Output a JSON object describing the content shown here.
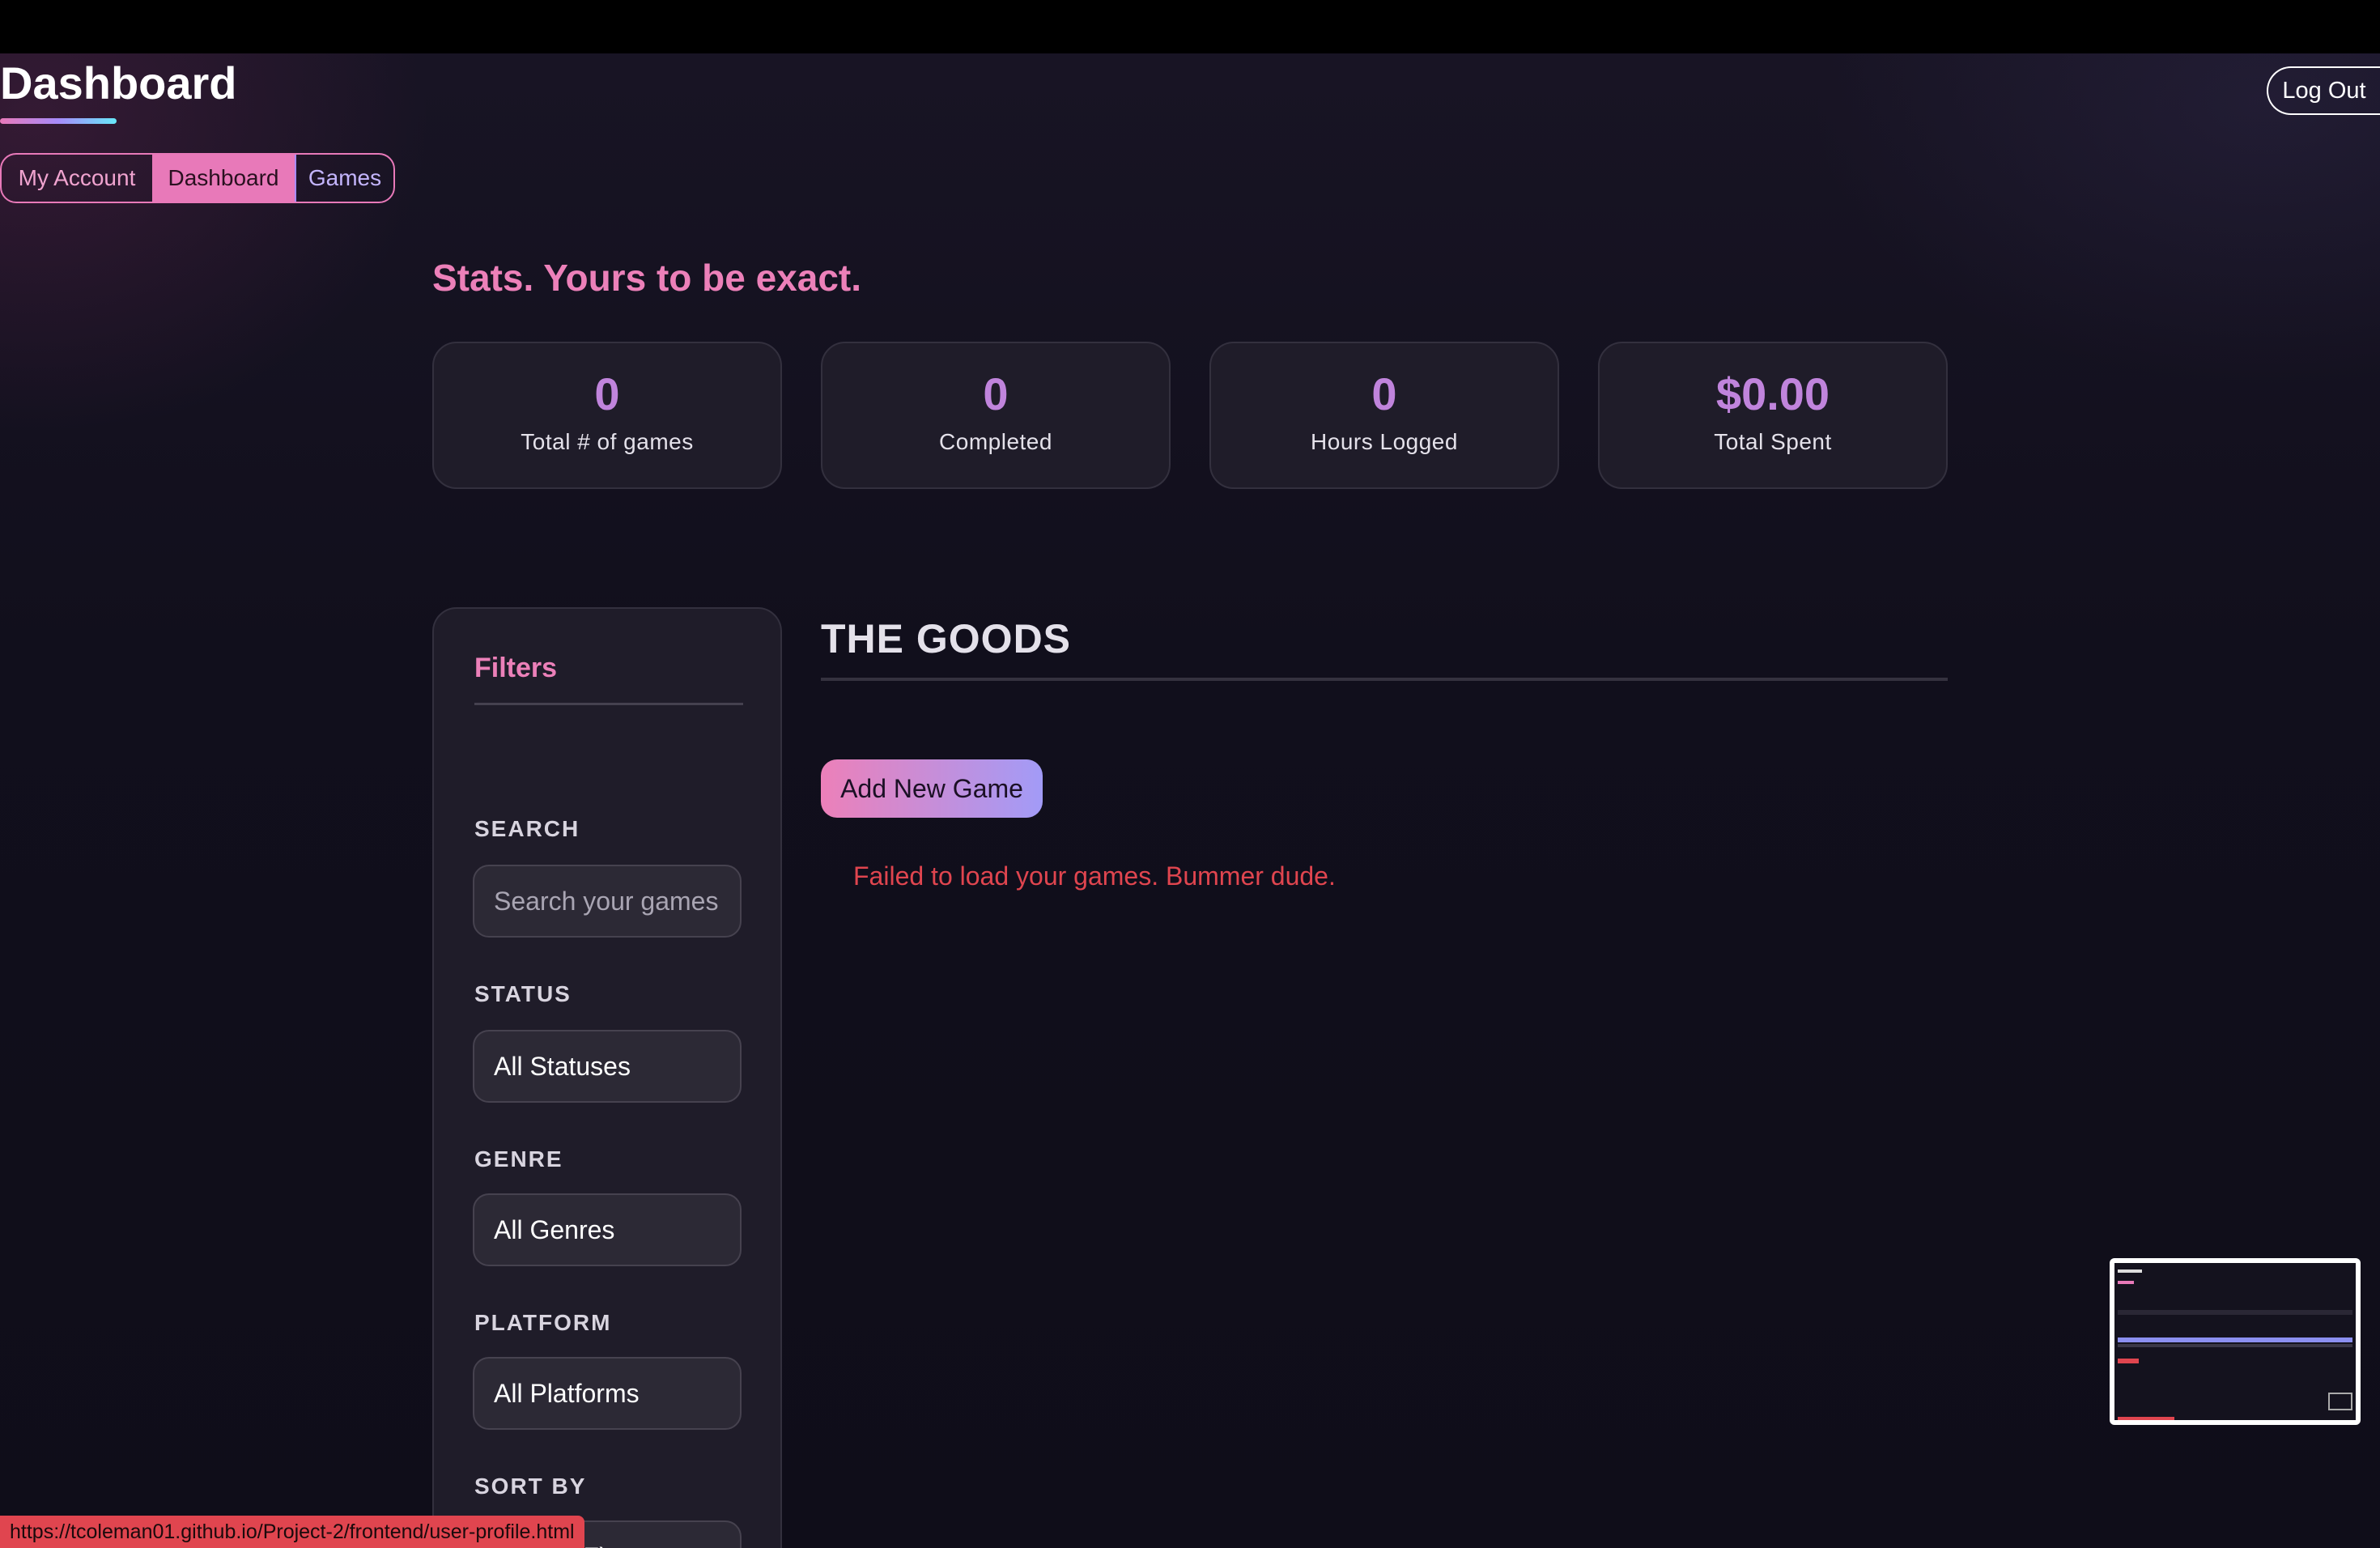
{
  "header": {
    "title": "Dashboard",
    "logout_label": "Log Out"
  },
  "nav": {
    "tabs": [
      {
        "label": "My Account"
      },
      {
        "label": "Dashboard"
      },
      {
        "label": "Games"
      }
    ],
    "active": "Dashboard"
  },
  "stats": {
    "heading": "Stats. Yours to be exact.",
    "cards": [
      {
        "value": "0",
        "label": "Total # of games"
      },
      {
        "value": "0",
        "label": "Completed"
      },
      {
        "value": "0",
        "label": "Hours Logged"
      },
      {
        "value": "$0.00",
        "label": "Total Spent"
      }
    ]
  },
  "filters": {
    "title": "Filters",
    "search_label": "SEARCH",
    "search_placeholder": "Search your games",
    "status_label": "STATUS",
    "status_value": "All Statuses",
    "genre_label": "GENRE",
    "genre_value": "All Genres",
    "platform_label": "PLATFORM",
    "platform_value": "All Platforms",
    "sort_label": "SORT BY",
    "sort_value": "Title (A-Z)"
  },
  "goods": {
    "title": "THE GOODS",
    "add_button": "Add New Game",
    "error_message": "Failed to load your games. Bummer dude."
  },
  "statusbar": {
    "url": "https://tcoleman01.github.io/Project-2/frontend/user-profile.html"
  },
  "colors": {
    "accent_pink": "#e879b9",
    "accent_purple": "#c084dc",
    "error_red": "#e0454f",
    "background": "#0f0d19",
    "card": "#1f1c29"
  }
}
